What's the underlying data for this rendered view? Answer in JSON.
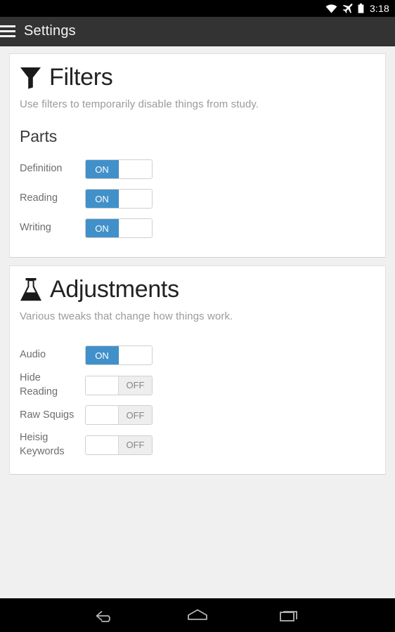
{
  "status_bar": {
    "icons": [
      "wifi-icon",
      "airplane-mode-icon",
      "battery-icon"
    ],
    "time": "3:18",
    "background_color": "#000000"
  },
  "action_bar": {
    "menu_icon": "hamburger-menu-icon",
    "title": "Settings",
    "background_color": "#333333"
  },
  "cards": [
    {
      "icon": "funnel-filter-icon",
      "title": "Filters",
      "subtitle": "Use filters to temporarily disable things from study.",
      "section_title": "Parts",
      "rows": [
        {
          "label": "Definition",
          "state": "ON"
        },
        {
          "label": "Reading",
          "state": "ON"
        },
        {
          "label": "Writing",
          "state": "ON"
        }
      ]
    },
    {
      "icon": "flask-beaker-icon",
      "title": "Adjustments",
      "subtitle": "Various tweaks that change how things work.",
      "section_title": "",
      "rows": [
        {
          "label": "Audio",
          "state": "ON"
        },
        {
          "label": "Hide Reading",
          "state": "OFF"
        },
        {
          "label": "Raw Squigs",
          "state": "OFF"
        },
        {
          "label": "Heisig Keywords",
          "state": "OFF"
        }
      ]
    }
  ],
  "toggle_labels": {
    "on": "ON",
    "off": "OFF"
  },
  "colors": {
    "accent_blue": "#4190ca",
    "page_background": "#f0f0f0",
    "card_background": "#ffffff",
    "off_track": "#eeeeee"
  },
  "nav_bar": {
    "buttons": [
      "back-icon",
      "home-icon",
      "recents-icon"
    ],
    "background_color": "#000000"
  }
}
